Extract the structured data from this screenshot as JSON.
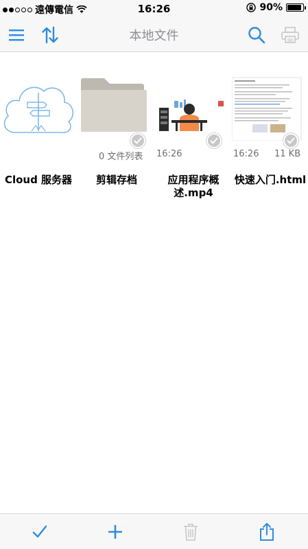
{
  "status": {
    "carrier": "遠傳電信",
    "time": "16:26",
    "battery": "90%",
    "battery_level": 0.9
  },
  "nav": {
    "title": "本地文件"
  },
  "files": [
    {
      "label": "Cloud 服务器",
      "meta_left": "",
      "meta_right": ""
    },
    {
      "label": "剪辑存档",
      "meta_left": "0 文件列表",
      "meta_right": ""
    },
    {
      "label": "应用程序概述.mp4",
      "meta_left": "16:26",
      "meta_right": ""
    },
    {
      "label": "快速入门.html",
      "meta_left": "16:26",
      "meta_right": "11 KB"
    }
  ],
  "colors": {
    "accent": "#2d8cdc",
    "disabled": "#c7c7cc"
  }
}
